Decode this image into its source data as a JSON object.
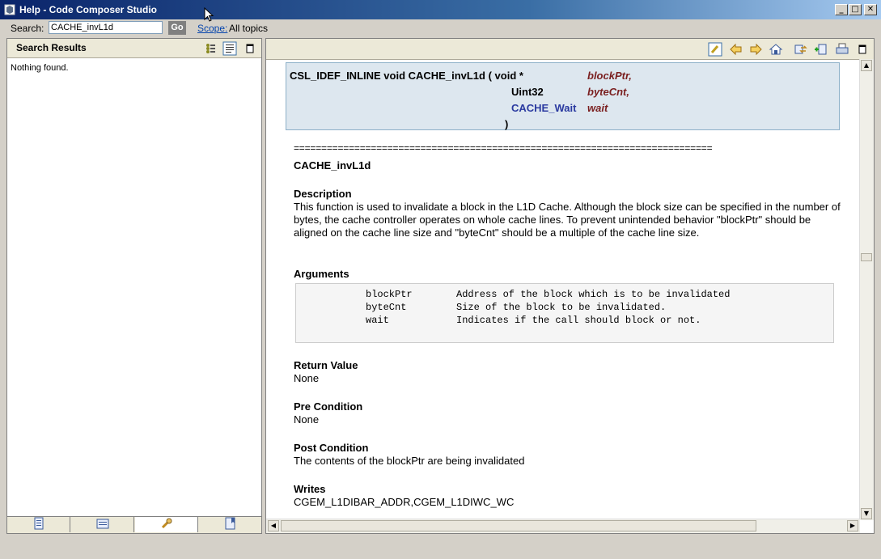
{
  "window": {
    "title": "Help - Code Composer Studio",
    "minimize_glyph": "_",
    "maximize_glyph": "□",
    "close_glyph": "✕"
  },
  "search": {
    "label": "Search:",
    "value": "CACHE_invL1d",
    "go_label": "Go",
    "scope_link": "Scope:",
    "scope_value": "All topics"
  },
  "left_pane": {
    "title": "Search Results",
    "message": "Nothing found.",
    "tab_icons": [
      "contents-icon",
      "index-icon",
      "search-icon",
      "bookmarks-icon"
    ]
  },
  "toolbar_icons": [
    "highlight-icon",
    "back-arrow-icon",
    "forward-arrow-icon",
    "home-icon",
    "sync-icon",
    "bookmark-add-icon",
    "print-icon",
    "maximize-icon"
  ],
  "signature": {
    "prefix": "CSL_IDEF_INLINE void CACHE_invL1d ( void *",
    "params": [
      {
        "type": "",
        "name": "blockPtr,"
      },
      {
        "type": "Uint32",
        "name": "byteCnt,"
      },
      {
        "type": "CACHE_Wait",
        "name": "wait"
      }
    ],
    "close": ")"
  },
  "doc": {
    "separator": "============================================================================",
    "func_name": "CACHE_invL1d",
    "desc_heading": "Description",
    "desc_text": "This function is used to invalidate a block in the L1D Cache. Although the block size can be specified in the number of bytes, the cache controller operates on whole cache lines. To prevent unintended behavior \"blockPtr\" should be aligned on the cache line size and \"byteCnt\" should be a multiple of the cache line size.",
    "args_heading": "Arguments",
    "args": [
      {
        "name": "blockPtr",
        "desc": "Address of the block which is to be invalidated"
      },
      {
        "name": "byteCnt",
        "desc": "Size of the block to be invalidated."
      },
      {
        "name": "wait",
        "desc": "Indicates if the call should block or not."
      }
    ],
    "return_heading": "Return Value",
    "return_text": "None",
    "pre_heading": "Pre Condition",
    "pre_text": "None",
    "post_heading": "Post Condition",
    "post_text": "The contents of the blockPtr are being invalidated",
    "writes_heading": "Writes",
    "writes_text": "CGEM_L1DIBAR_ADDR,CGEM_L1DIWC_WC"
  }
}
